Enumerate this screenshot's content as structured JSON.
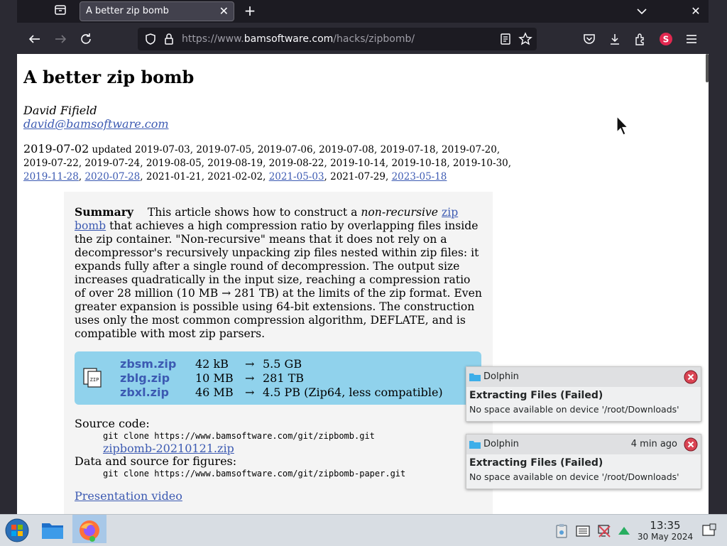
{
  "browser": {
    "tab_title": "A better zip bomb",
    "url_prefix": "https://www.",
    "url_domain": "bamsoftware.com",
    "url_path": "/hacks/zipbomb/"
  },
  "article": {
    "title": "A better zip bomb",
    "author": "David Fifield",
    "email": "david@bamsoftware.com",
    "date_first": "2019-07-02",
    "date_updated_prefix": " updated 2019-07-03, 2019-07-05, 2019-07-06, 2019-07-08, 2019-07-18, 2019-07-20, 2019-07-22, 2019-07-24, 2019-08-05, 2019-08-19, 2019-08-22, 2019-10-14, 2019-10-18, 2019-10-30, ",
    "date_link_1": "2019-11-28",
    "date_sep_1": ", ",
    "date_link_2": "2020-07-28",
    "date_sep_2": ", 2021-01-21, 2021-02-02, ",
    "date_link_3": "2021-05-03",
    "date_sep_3": ", 2021-07-29, ",
    "date_link_4": "2023-05-18",
    "summary_label": "Summary",
    "summary_1": "This article shows how to construct a ",
    "summary_italic": "non-recursive",
    "summary_link": "zip bomb",
    "summary_2": " that achieves a high compression ratio by overlapping files inside the zip container. \"Non-recursive\" means that it does not rely on a decompressor's recursively unpacking zip files nested within zip files: it expands fully after a single round of decompression. The output size increases quadratically in the input size, reaching a compression ratio of over 28 million (10 MB → 281 TB) at the limits of the zip format. Even greater expansion is possible using 64-bit extensions. The construction uses only the most common compression algorithm, DEFLATE, and is compatible with most zip parsers.",
    "downloads": [
      {
        "name": "zbsm.zip",
        "size": "42 kB",
        "arrow": "→",
        "output": "5.5 GB"
      },
      {
        "name": "zblg.zip",
        "size": "10 MB",
        "arrow": "→",
        "output": "281 TB"
      },
      {
        "name": "zbxl.zip",
        "size": "46 MB",
        "arrow": "→",
        "output": "4.5 PB (Zip64, less compatible)"
      }
    ],
    "source_label": "Source code:",
    "source_cmd": "git clone https://www.bamsoftware.com/git/zipbomb.git",
    "source_zip": "zipbomb-20210121.zip",
    "data_label": "Data and source for figures:",
    "data_cmd": "git clone https://www.bamsoftware.com/git/zipbomb-paper.git",
    "video_link": "Presentation video"
  },
  "notifications": [
    {
      "app": "Dolphin",
      "time": "",
      "title": "Extracting Files (Failed)",
      "body": "No space available on device '/root/Downloads'"
    },
    {
      "app": "Dolphin",
      "time": "4 min ago",
      "title": "Extracting Files (Failed)",
      "body": "No space available on device '/root/Downloads'"
    }
  ],
  "taskbar": {
    "time": "13:35",
    "date": "30 May 2024"
  },
  "colors": {
    "link": "#3c5ab2",
    "download_box": "#90d2ec",
    "browser_chrome": "#2b2a33"
  }
}
